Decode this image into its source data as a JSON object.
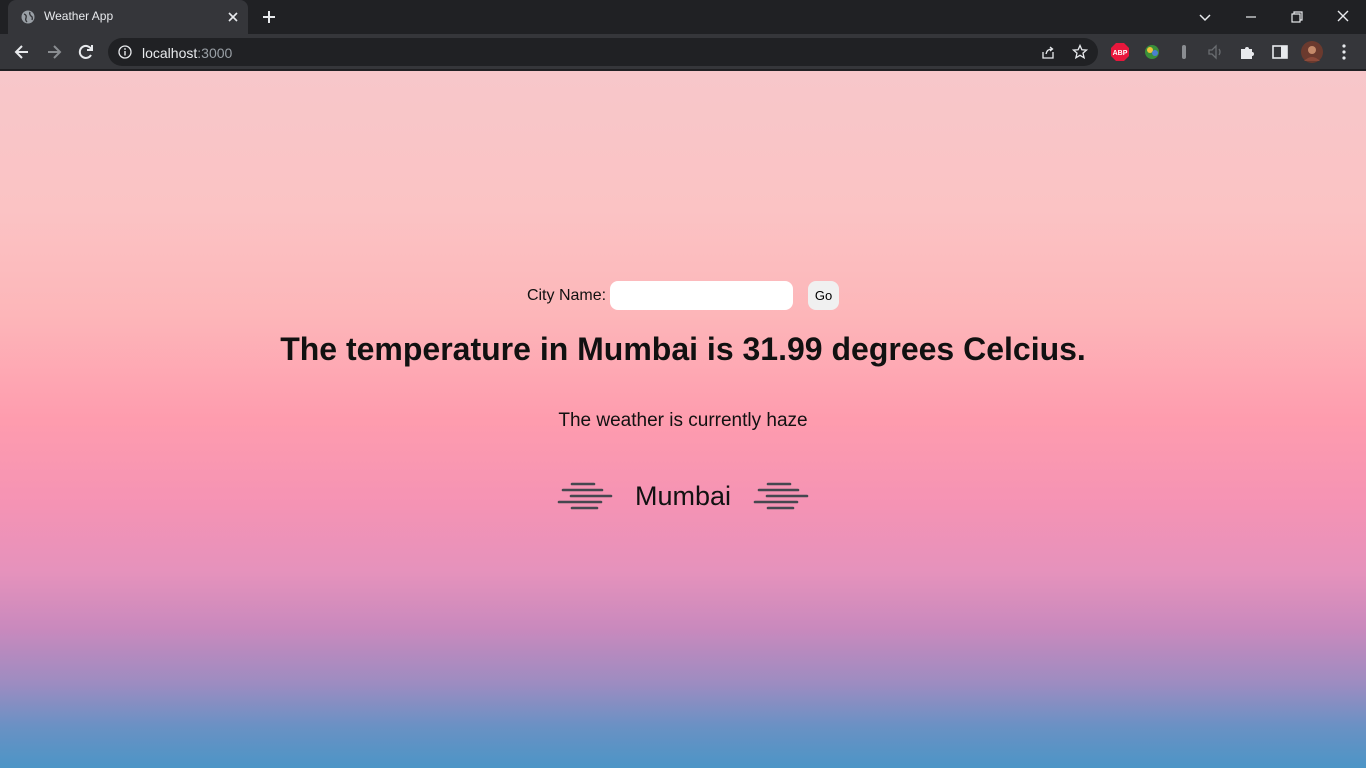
{
  "browser": {
    "tab_title": "Weather App",
    "url_host": "localhost",
    "url_port": ":3000",
    "extensions": [
      "adblock-plus-icon",
      "extension-icon",
      "extension-icon",
      "media-icon",
      "puzzle-icon"
    ]
  },
  "page": {
    "form": {
      "label": "City Name:",
      "input_value": "",
      "input_placeholder": "",
      "button_label": "Go"
    },
    "temperature_text": "The temperature in Mumbai is 31.99 degrees Celcius.",
    "description_text": "The weather is currently haze",
    "city_name": "Mumbai"
  },
  "colors": {
    "gradient_top": "#f7c7ca",
    "gradient_mid": "#fe9cae",
    "gradient_bottom": "#4c95c6"
  }
}
